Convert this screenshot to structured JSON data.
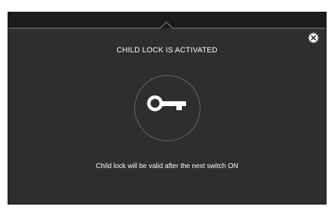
{
  "screen": {
    "title": "CHILD LOCK IS ACTIVATED",
    "message": "Child lock will be valid after the next switch ON"
  },
  "icons": {
    "close": "close-circle-icon",
    "key": "key-icon"
  },
  "colors": {
    "background": "#2e2e2e",
    "top_bar": "#1c1c1c",
    "text": "#ffffff",
    "circle_outline": "#6a6a6a"
  }
}
